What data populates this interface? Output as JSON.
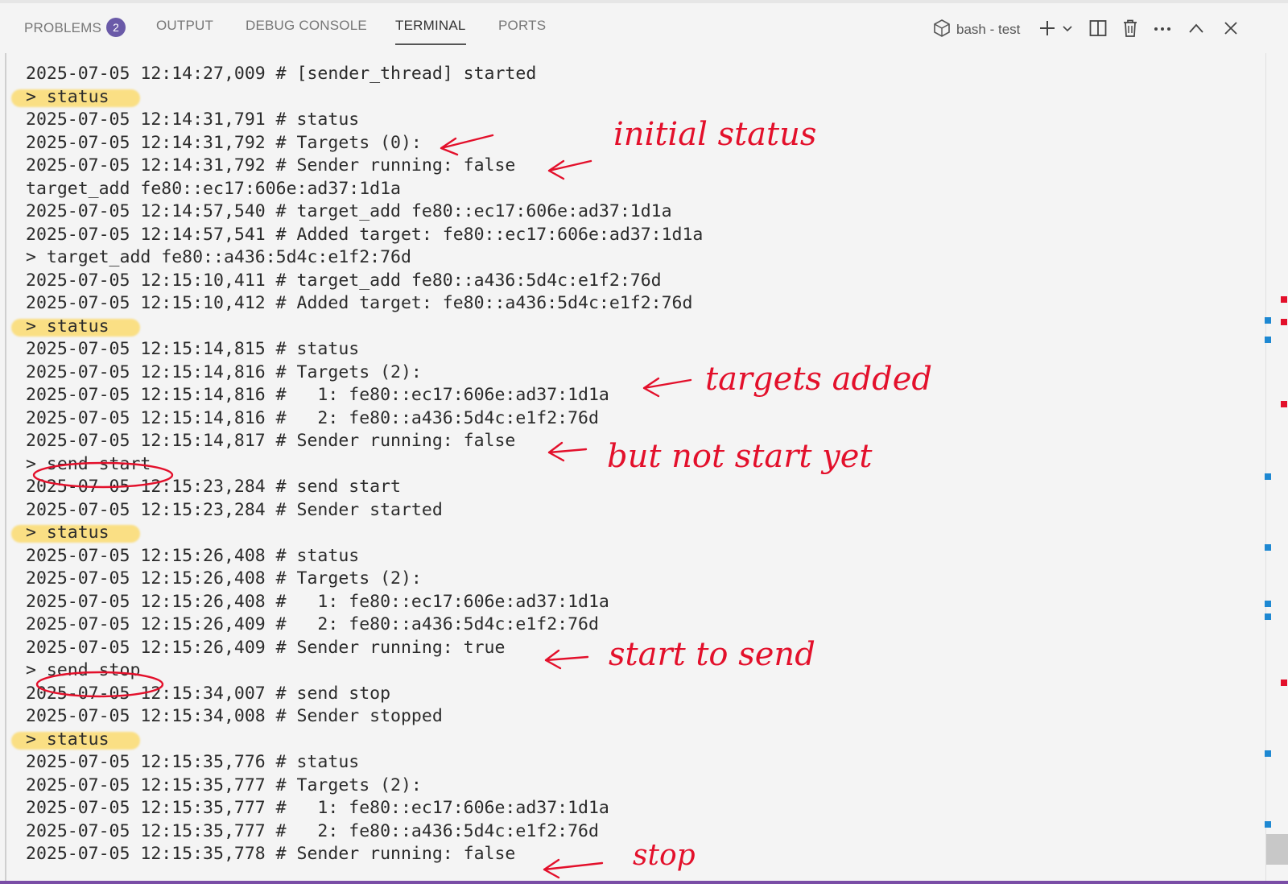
{
  "tabs": [
    {
      "label": "PROBLEMS",
      "badge": "2"
    },
    {
      "label": "OUTPUT"
    },
    {
      "label": "DEBUG CONSOLE"
    },
    {
      "label": "TERMINAL",
      "active": true
    },
    {
      "label": "PORTS"
    }
  ],
  "terminal_toolbar": {
    "shell_label": "bash - test",
    "icons": [
      "terminal-profile-icon",
      "add-icon",
      "chevron-down-icon",
      "split-icon",
      "trash-icon",
      "more-icon",
      "maximize-icon",
      "close-icon"
    ]
  },
  "terminal_lines": [
    "2025-07-05 12:14:27,009 # [sender_thread] started",
    "> status",
    "2025-07-05 12:14:31,791 # status",
    "2025-07-05 12:14:31,792 # Targets (0):",
    "2025-07-05 12:14:31,792 # Sender running: false",
    "target_add fe80::ec17:606e:ad37:1d1a",
    "2025-07-05 12:14:57,540 # target_add fe80::ec17:606e:ad37:1d1a",
    "2025-07-05 12:14:57,541 # Added target: fe80::ec17:606e:ad37:1d1a",
    "> target_add fe80::a436:5d4c:e1f2:76d",
    "2025-07-05 12:15:10,411 # target_add fe80::a436:5d4c:e1f2:76d",
    "2025-07-05 12:15:10,412 # Added target: fe80::a436:5d4c:e1f2:76d",
    "> status",
    "2025-07-05 12:15:14,815 # status",
    "2025-07-05 12:15:14,816 # Targets (2):",
    "2025-07-05 12:15:14,816 #   1: fe80::ec17:606e:ad37:1d1a",
    "2025-07-05 12:15:14,816 #   2: fe80::a436:5d4c:e1f2:76d",
    "2025-07-05 12:15:14,817 # Sender running: false",
    "> send start",
    "2025-07-05 12:15:23,284 # send start",
    "2025-07-05 12:15:23,284 # Sender started",
    "> status",
    "2025-07-05 12:15:26,408 # status",
    "2025-07-05 12:15:26,408 # Targets (2):",
    "2025-07-05 12:15:26,408 #   1: fe80::ec17:606e:ad37:1d1a",
    "2025-07-05 12:15:26,409 #   2: fe80::a436:5d4c:e1f2:76d",
    "2025-07-05 12:15:26,409 # Sender running: true",
    "> send stop",
    "2025-07-05 12:15:34,007 # send stop",
    "2025-07-05 12:15:34,008 # Sender stopped",
    "> status",
    "2025-07-05 12:15:35,776 # status",
    "2025-07-05 12:15:35,777 # Targets (2):",
    "2025-07-05 12:15:35,777 #   1: fe80::ec17:606e:ad37:1d1a",
    "2025-07-05 12:15:35,777 #   2: fe80::a436:5d4c:e1f2:76d",
    "2025-07-05 12:15:35,778 # Sender running: false"
  ],
  "highlighted_lines": [
    1,
    11,
    20,
    29
  ],
  "annotations": {
    "initial_status": "initial status",
    "targets_added": "targets added",
    "but_not_start_yet": "but not start yet",
    "start_to_send": "start to send",
    "stop": "stop"
  },
  "colors": {
    "annotation": "#e3102b",
    "highlight": "#ffcd28",
    "badge": "#6a5aa8",
    "status_bar": "#7a4da6"
  }
}
